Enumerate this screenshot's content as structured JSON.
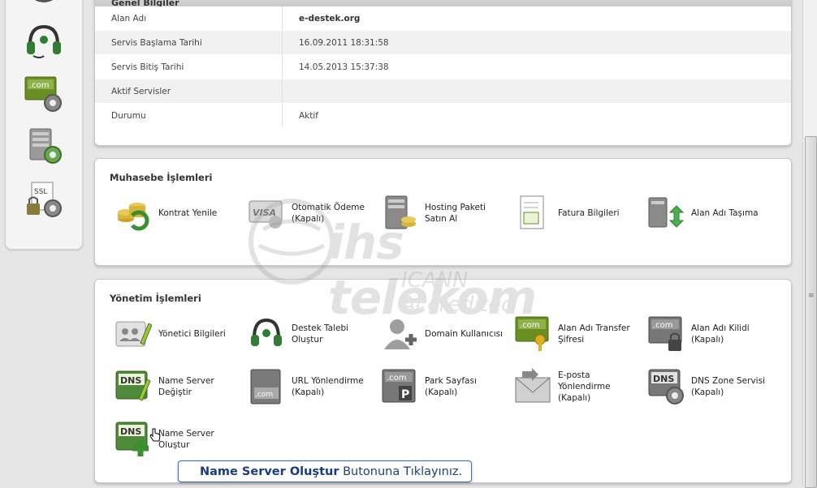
{
  "genel": {
    "title": "Genel Bilgiler",
    "rows": [
      {
        "label": "Alan Adı",
        "value": "e-destek.org"
      },
      {
        "label": "Servis Başlama Tarihi",
        "value": "16.09.2011 18:31:58"
      },
      {
        "label": "Servis Bitiş Tarihi",
        "value": "14.05.2013 15:37:38"
      },
      {
        "label": "Aktif Servisler",
        "value": ""
      },
      {
        "label": "Durumu",
        "value": "Aktif"
      }
    ]
  },
  "muhasebe": {
    "title": "Muhasebe İşlemleri",
    "items": [
      {
        "label": "Kontrat Yenile"
      },
      {
        "label": "Otomatik Ödeme (Kapalı)"
      },
      {
        "label": "Hosting Paketi Satın Al"
      },
      {
        "label": "Fatura Bilgileri"
      },
      {
        "label": "Alan Adı Taşıma"
      }
    ]
  },
  "yonetim": {
    "title": "Yönetim İşlemleri",
    "items": [
      {
        "label": "Yönetici Bilgileri"
      },
      {
        "label": "Destek Talebi Oluştur"
      },
      {
        "label": "Domain Kullanıcısı"
      },
      {
        "label": "Alan Adı Transfer Şifresi"
      },
      {
        "label": "Alan Adı Kilidi (Kapalı)"
      },
      {
        "label": "Name Server Değiştir"
      },
      {
        "label": "URL Yönlendirme (Kapalı)"
      },
      {
        "label": "Park Sayfası (Kapalı)"
      },
      {
        "label": "E-posta Yönlendirme (Kapalı)"
      },
      {
        "label": "DNS Zone Servisi (Kapalı)"
      },
      {
        "label": "Name Server Oluştur"
      }
    ]
  },
  "icon_text": {
    "com": ".com",
    "ssl": "SSL",
    "visa": "VISA",
    "dns": "DNS"
  },
  "watermark": {
    "brand": "ihs telekom",
    "sub": "ICANN Accredited"
  },
  "callout": {
    "bold": "Name Server Oluştur",
    "rest": " Butonuna Tıklayınız."
  },
  "colors": {
    "dns_green": "#4f8a3a",
    "callout_blue": "#1a3b82"
  }
}
